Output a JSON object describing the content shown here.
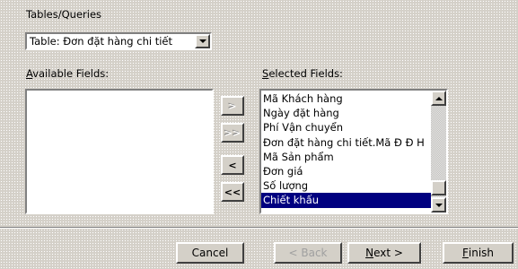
{
  "source_section": {
    "label": "Tables/Queries",
    "selected": "Table: Đơn đặt hàng chi tiết"
  },
  "available": {
    "label_accel": "A",
    "label_rest": "vailable Fields:",
    "items": []
  },
  "selected_fields": {
    "label_accel": "S",
    "label_rest": "elected Fields:",
    "items": [
      "Mã Khách hàng",
      "Ngày đặt hàng",
      "Phí Vận chuyển",
      "Đơn đặt hàng chi tiết.Mã Đ Đ H",
      "Mã Sản phẩm",
      "Đơn giá",
      "Số lượng",
      "Chiết khấu"
    ],
    "selected_item": "Chiết khấu"
  },
  "move_buttons": {
    "add_one": ">",
    "add_all": ">>",
    "remove_one": "<",
    "remove_all": "<<"
  },
  "footer": {
    "cancel": "Cancel",
    "back": "< Back",
    "next_accel": "N",
    "next_rest": "ext >",
    "finish_accel": "F",
    "finish_rest": "inish"
  }
}
